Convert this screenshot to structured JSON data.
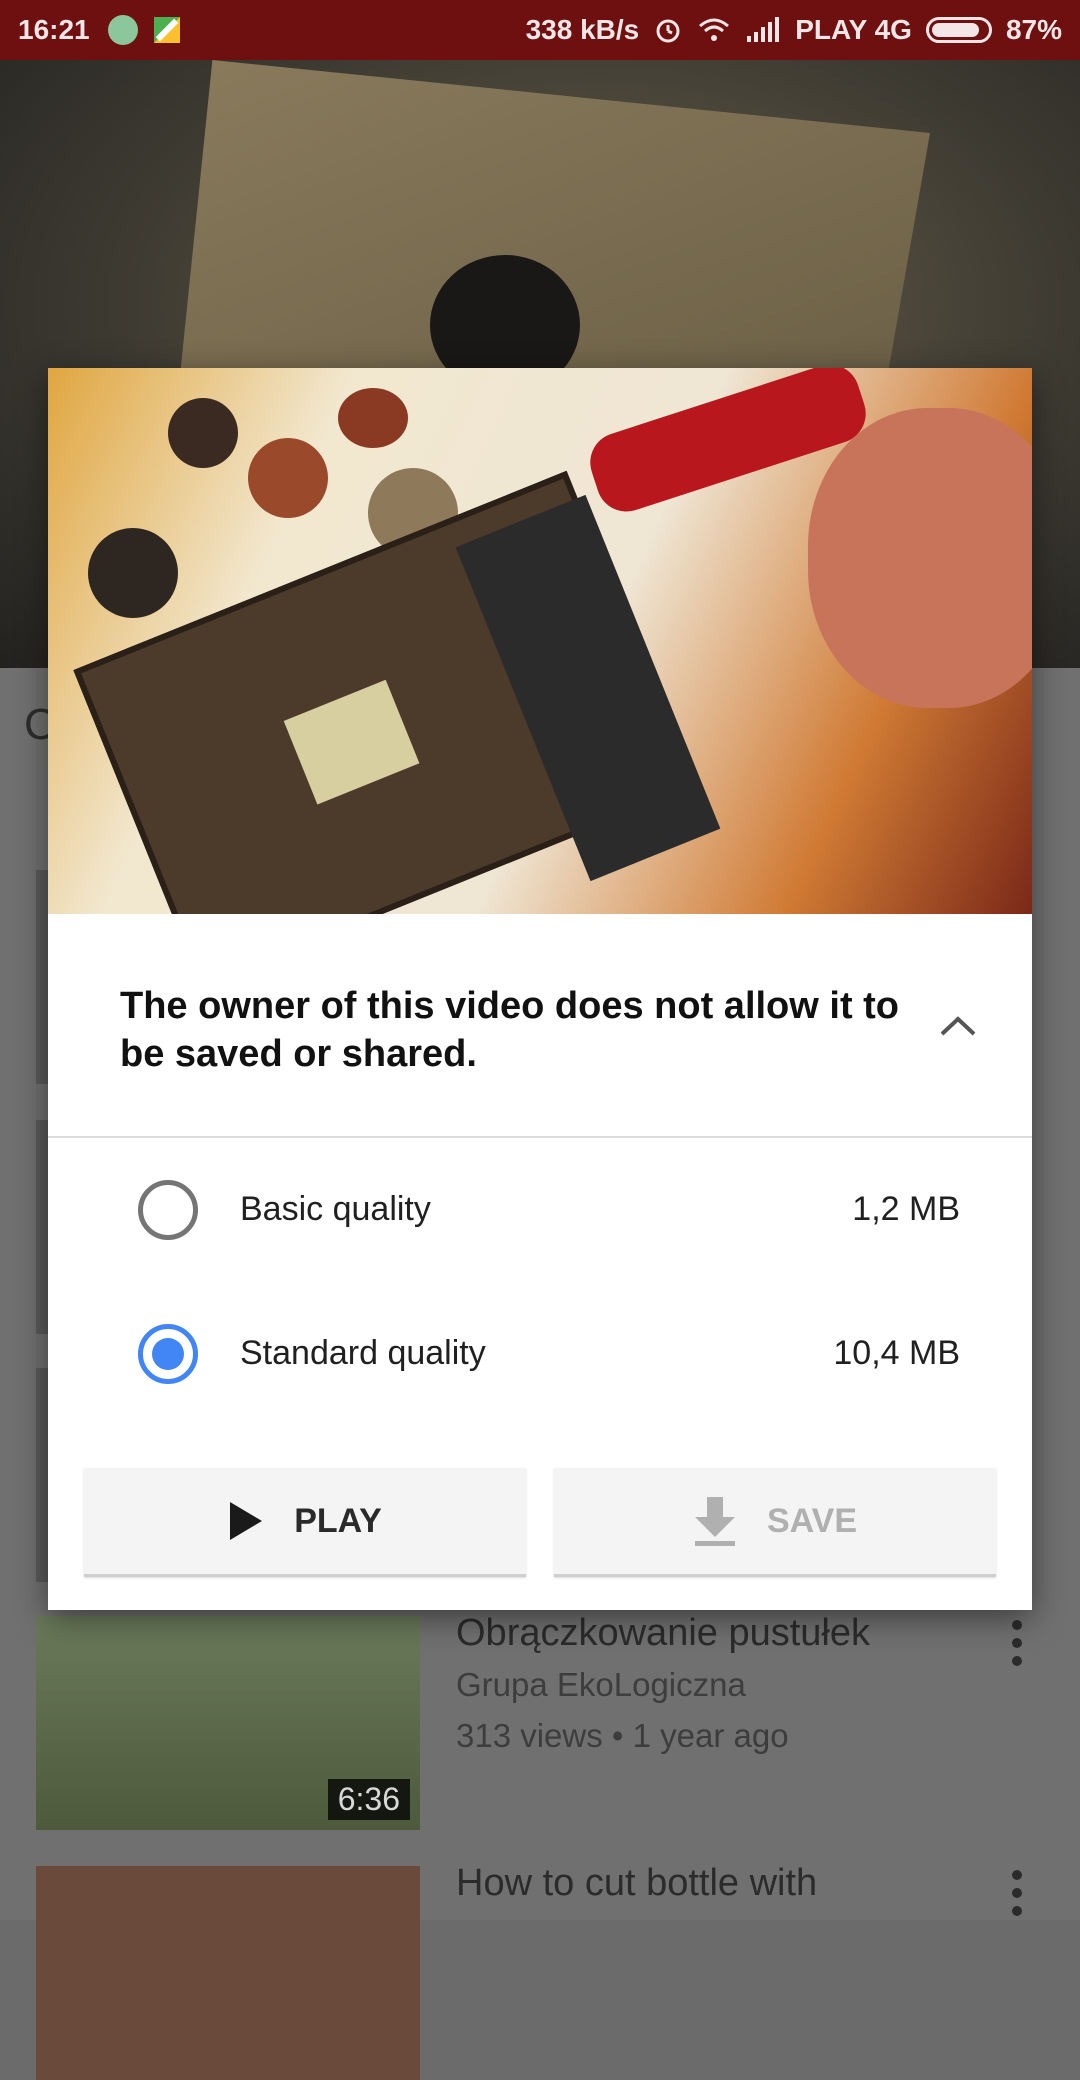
{
  "status_bar": {
    "time": "16:21",
    "speed": "338 kB/s",
    "carrier": "PLAY 4G",
    "battery": "87%",
    "battery_level": 0.87,
    "icons": [
      "app-notification-icon",
      "maps-icon",
      "alarm-icon",
      "wifi-icon",
      "signal-icon",
      "battery-icon"
    ]
  },
  "background": {
    "heading_fragment": "C",
    "items": [
      {
        "title": "Obrączkowanie pustułek",
        "channel": "Grupa EkoLogiczna",
        "meta": "313 views • 1 year ago",
        "duration": "6:36"
      },
      {
        "title": "How to cut bottle with",
        "channel": "",
        "meta": "",
        "duration": ""
      }
    ]
  },
  "dialog": {
    "message": "The owner of this video does not allow it to be saved or shared.",
    "options": [
      {
        "label": "Basic quality",
        "size": "1,2 MB",
        "selected": false
      },
      {
        "label": "Standard quality",
        "size": "10,4 MB",
        "selected": true
      }
    ],
    "play_label": "PLAY",
    "save_label": "SAVE",
    "accent_color": "#4285f4"
  }
}
